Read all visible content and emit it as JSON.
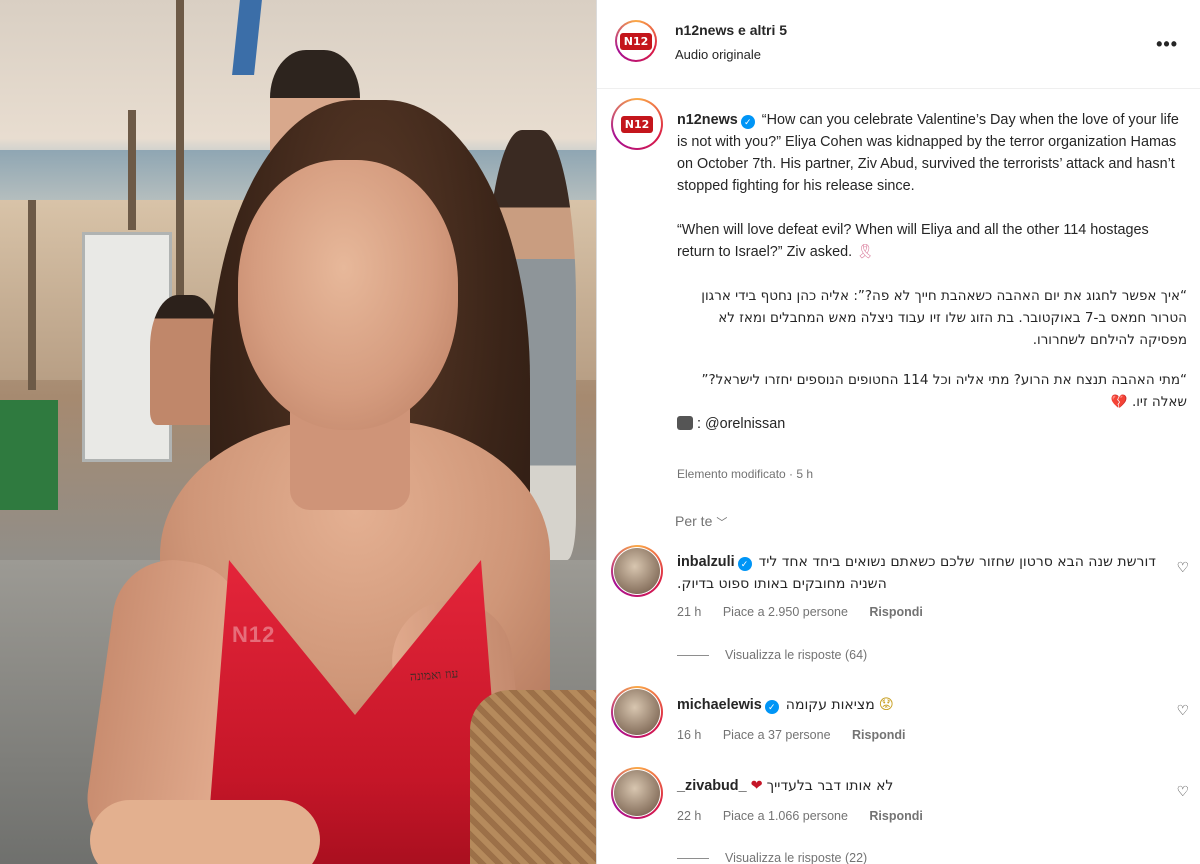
{
  "header": {
    "title": "n12news e altri 5",
    "subtitle": "Audio originale",
    "avatar_logo": "N12",
    "more_icon": "more-horizontal-icon"
  },
  "caption": {
    "username": "n12news",
    "avatar_logo": "N12",
    "p1": "“How can you celebrate Valentine’s Day when the love of your life is not with you?” Eliya Cohen was kidnapped by the terror organization Hamas on October 7th. His partner, Ziv Abud, survived the terrorists’ attack and hasn’t stopped fighting for his release since.",
    "p2": "“When will love defeat evil? When will Eliya and all the other 114 hostages return to Israel?” Ziv asked.",
    "p2_emoji": "🎗",
    "p3": "“איך אפשר לחגוג את יום האהבה כשאהבת חייך לא פה?”: אליה כהן נחטף בידי ארגון הטרור חמאס ב-7 באוקטובר. בת הזוג שלו זיו עבוד ניצלה מאש המחבלים ומאז לא מפסיקה להילחם לשחרורו.",
    "p4": "“מתי האהבה תנצח את הרוע? מתי אליה וכל 114 החטופים הנוספים יחזרו לישראל?” שאלה זיו.",
    "p4_emoji": "💔",
    "credit_prefix": ":",
    "credit": "@orelnissan",
    "edited": "Elemento modificato · 5 h"
  },
  "for_you": {
    "label": "Per te",
    "icon": "chevron-down-icon"
  },
  "comments": [
    {
      "username": "inbalzuli",
      "verified": true,
      "text": "דורשת שנה הבא סרטון שחזור שלכם כשאתם נשואים ביחד אחד ליד השניה מחובקים באותו ספוט בדיוק.",
      "time": "21 h",
      "likes": "Piace a 2.950 persone",
      "reply": "Rispondi",
      "view_replies": "Visualizza le risposte (64)"
    },
    {
      "username": "michaelewis",
      "verified": true,
      "text": "מציאות עקומה",
      "emoji": "😟",
      "time": "16 h",
      "likes": "Piace a 37 persone",
      "reply": "Rispondi"
    },
    {
      "username": "_zivabud_",
      "verified": false,
      "text": "לא אותו דבר בלעדייך",
      "emoji": "❤",
      "time": "22 h",
      "likes": "Piace a 1.066 persone",
      "reply": "Rispondi",
      "view_replies": "Visualizza le risposte (22)"
    }
  ],
  "photo": {
    "watermark": "N12",
    "tattoo_text": "עוז ואמונה"
  },
  "colors": {
    "accent": "#0095f6",
    "brand": "#c4161c",
    "muted": "#737373"
  }
}
